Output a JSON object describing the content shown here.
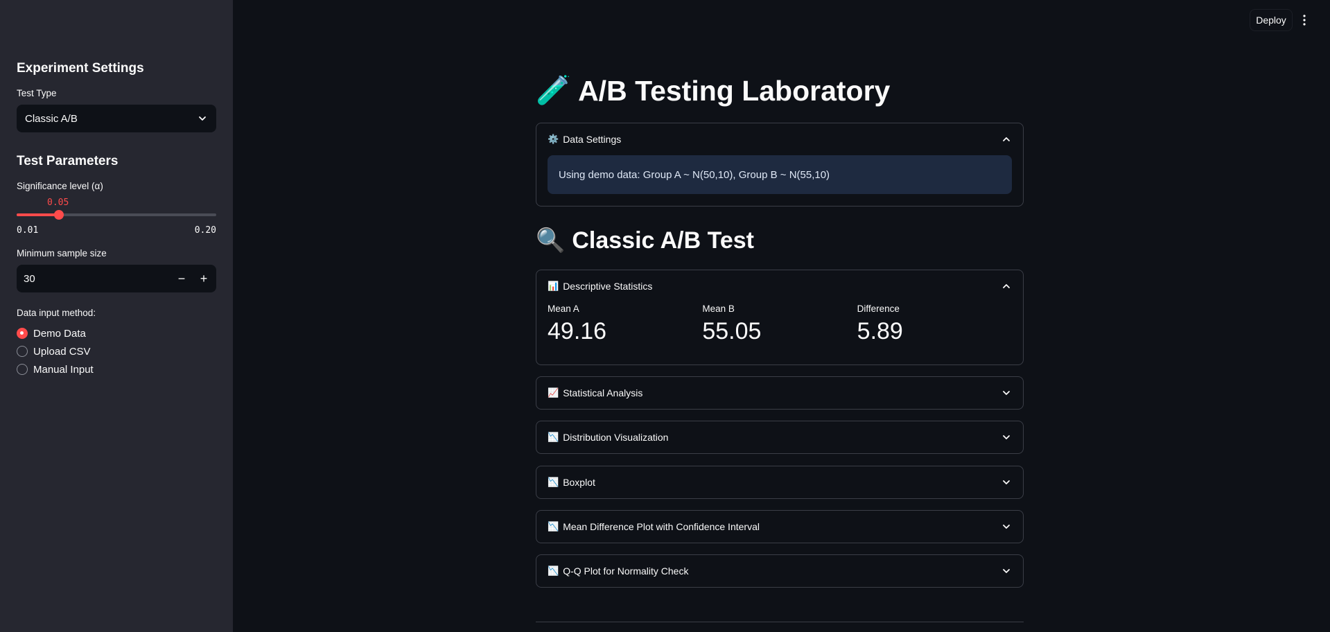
{
  "topbar": {
    "deploy_label": "Deploy"
  },
  "sidebar": {
    "experiment_heading": "Experiment Settings",
    "test_type_label": "Test Type",
    "test_type_value": "Classic A/B",
    "test_params_heading": "Test Parameters",
    "alpha": {
      "label": "Significance level (α)",
      "value": "0.05",
      "min": "0.01",
      "max": "0.20",
      "fraction": 0.211
    },
    "min_sample": {
      "label": "Minimum sample size",
      "value": "30",
      "minus": "−",
      "plus": "+"
    },
    "data_input": {
      "label": "Data input method:",
      "options": [
        "Demo Data",
        "Upload CSV",
        "Manual Input"
      ],
      "selected": "Demo Data"
    }
  },
  "main": {
    "title": "A/B Testing Laboratory",
    "title_emoji": "🧪",
    "data_settings": {
      "icon": "⚙️",
      "label": "Data Settings",
      "info": "Using demo data: Group A ~ N(50,10), Group B ~ N(55,10)"
    },
    "section_title": "Classic A/B Test",
    "section_emoji": "🔍",
    "descriptive": {
      "icon": "📊",
      "label": "Descriptive Statistics",
      "metrics": [
        {
          "label": "Mean A",
          "value": "49.16"
        },
        {
          "label": "Mean B",
          "value": "55.05"
        },
        {
          "label": "Difference",
          "value": "5.89"
        }
      ]
    },
    "collapsed": [
      {
        "icon": "📈",
        "label": "Statistical Analysis"
      },
      {
        "icon": "📉",
        "label": "Distribution Visualization"
      },
      {
        "icon": "📉",
        "label": "Boxplot"
      },
      {
        "icon": "📉",
        "label": "Mean Difference Plot with Confidence Interval"
      },
      {
        "icon": "📉",
        "label": "Q-Q Plot for Normality Check"
      }
    ]
  },
  "colors": {
    "accent": "#ff4b4b",
    "sidebar_bg": "#262730",
    "main_bg": "#0e1117",
    "info_bg": "#1e2a40"
  }
}
